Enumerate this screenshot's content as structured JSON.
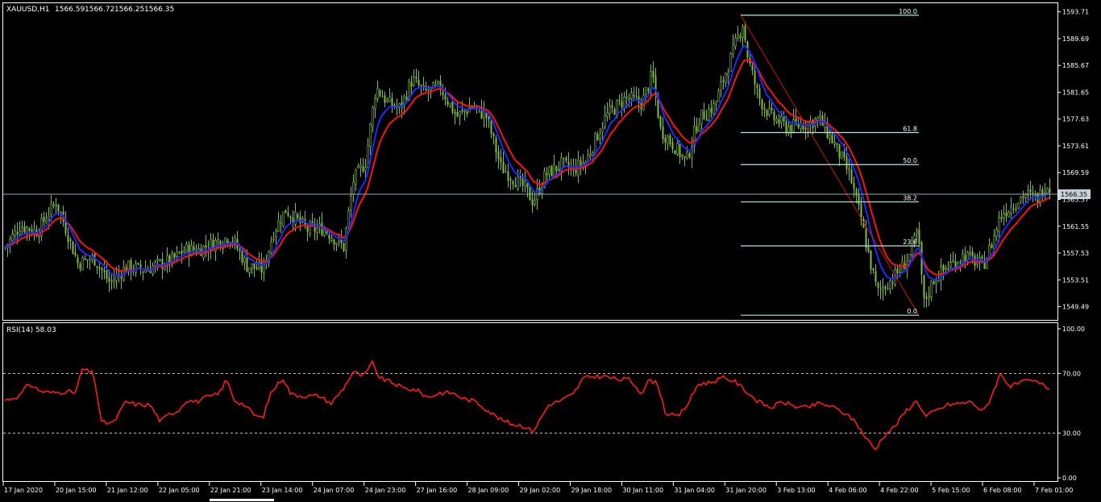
{
  "header": {
    "symbol": "XAUUSD,H1",
    "ohlc": [
      "1566.59",
      "1566.72",
      "1566.25",
      "1566.35"
    ]
  },
  "colors": {
    "background": "#000000",
    "frame": "#ffffff",
    "bull_candle": "#7fbf3f",
    "fast_ma": "#1c2bff",
    "slow_ma": "#ff1010",
    "fib_line": "#b0e6e6",
    "fib_trend": "#cc1010",
    "bid_line": "#8fa6b4",
    "rsi_line": "#ff1a1a",
    "rsi_level": "#bfbfbf"
  },
  "main_panel": {
    "price_ticks": [
      "1593.71",
      "1589.69",
      "1585.67",
      "1581.65",
      "1577.63",
      "1573.61",
      "1569.59",
      "1565.57",
      "1561.55",
      "1557.53",
      "1553.51",
      "1549.49"
    ],
    "current_price": "1566.35",
    "fibonacci": [
      {
        "label": "100.0",
        "price": 1593.2
      },
      {
        "label": "61.8",
        "price": 1575.6
      },
      {
        "label": "50.0",
        "price": 1570.8
      },
      {
        "label": "38.2",
        "price": 1565.2
      },
      {
        "label": "23.6",
        "price": 1558.6
      },
      {
        "label": "0.0",
        "price": 1548.2
      }
    ]
  },
  "rsi_panel": {
    "title": "RSI(14) 58.03",
    "ticks": [
      "100.00",
      "70.00",
      "30.00",
      "0.00"
    ],
    "levels": [
      70,
      30
    ]
  },
  "time_axis": {
    "labels": [
      "17 Jan 2020",
      "20 Jan 15:00",
      "21 Jan 12:00",
      "22 Jan 05:00",
      "22 Jan 21:00",
      "23 Jan 14:00",
      "24 Jan 07:00",
      "24 Jan 23:00",
      "27 Jan 16:00",
      "28 Jan 09:00",
      "29 Jan 02:00",
      "29 Jan 18:00",
      "30 Jan 11:00",
      "31 Jan 04:00",
      "31 Jan 20:00",
      "3 Feb 13:00",
      "4 Feb 06:00",
      "4 Feb 22:00",
      "5 Feb 15:00",
      "6 Feb 08:00",
      "7 Feb 01:00"
    ]
  },
  "chart_data": {
    "type": "line",
    "title": "XAUUSD,H1",
    "ylim": [
      1547.5,
      1595.0
    ],
    "rsi_ylim": [
      0,
      100
    ],
    "grid": false,
    "price_anchors": [
      [
        0,
        1558.4
      ],
      [
        18,
        1561.6
      ],
      [
        40,
        1560.8
      ],
      [
        52,
        1563.2
      ],
      [
        63,
        1565.2
      ],
      [
        73,
        1562.0
      ],
      [
        90,
        1556.0
      ],
      [
        110,
        1556.8
      ],
      [
        130,
        1553.0
      ],
      [
        150,
        1555.4
      ],
      [
        172,
        1555.0
      ],
      [
        190,
        1555.8
      ],
      [
        207,
        1556.4
      ],
      [
        222,
        1558.0
      ],
      [
        240,
        1558.0
      ],
      [
        262,
        1559.2
      ],
      [
        280,
        1560.0
      ],
      [
        300,
        1555.6
      ],
      [
        320,
        1555.0
      ],
      [
        333,
        1560.8
      ],
      [
        348,
        1564.0
      ],
      [
        375,
        1561.0
      ],
      [
        395,
        1561.2
      ],
      [
        420,
        1558.4
      ],
      [
        432,
        1568.4
      ],
      [
        447,
        1571.2
      ],
      [
        460,
        1582.4
      ],
      [
        475,
        1580.0
      ],
      [
        490,
        1579.2
      ],
      [
        505,
        1583.6
      ],
      [
        520,
        1581.6
      ],
      [
        540,
        1582.4
      ],
      [
        560,
        1578.0
      ],
      [
        580,
        1579.6
      ],
      [
        597,
        1578.0
      ],
      [
        615,
        1570.4
      ],
      [
        630,
        1568.8
      ],
      [
        645,
        1567.2
      ],
      [
        655,
        1565.2
      ],
      [
        670,
        1569.2
      ],
      [
        690,
        1570.8
      ],
      [
        705,
        1570.0
      ],
      [
        720,
        1571.2
      ],
      [
        745,
        1578.0
      ],
      [
        770,
        1580.8
      ],
      [
        790,
        1580.0
      ],
      [
        803,
        1584.4
      ],
      [
        813,
        1576.0
      ],
      [
        830,
        1573.6
      ],
      [
        845,
        1571.2
      ],
      [
        860,
        1577.6
      ],
      [
        880,
        1579.6
      ],
      [
        898,
        1586.0
      ],
      [
        915,
        1592.0
      ],
      [
        922,
        1586.4
      ],
      [
        935,
        1580.8
      ],
      [
        950,
        1578.0
      ],
      [
        970,
        1576.4
      ],
      [
        990,
        1576.8
      ],
      [
        1010,
        1577.6
      ],
      [
        1030,
        1573.6
      ],
      [
        1048,
        1569.2
      ],
      [
        1062,
        1562.4
      ],
      [
        1072,
        1556.8
      ],
      [
        1082,
        1551.6
      ],
      [
        1100,
        1553.6
      ],
      [
        1112,
        1555.2
      ],
      [
        1122,
        1557.2
      ],
      [
        1132,
        1560.8
      ],
      [
        1140,
        1550.0
      ],
      [
        1152,
        1553.6
      ],
      [
        1170,
        1555.6
      ],
      [
        1190,
        1557.2
      ],
      [
        1213,
        1555.6
      ],
      [
        1225,
        1559.2
      ],
      [
        1235,
        1563.2
      ],
      [
        1250,
        1564.8
      ],
      [
        1265,
        1566.4
      ],
      [
        1280,
        1565.6
      ],
      [
        1292,
        1568.0
      ],
      [
        1300,
        1566.4
      ]
    ],
    "rsi_anchors": [
      [
        0,
        52
      ],
      [
        18,
        55
      ],
      [
        30,
        63
      ],
      [
        45,
        58
      ],
      [
        60,
        57
      ],
      [
        75,
        58
      ],
      [
        88,
        57
      ],
      [
        96,
        73
      ],
      [
        110,
        70
      ],
      [
        120,
        37
      ],
      [
        135,
        37
      ],
      [
        150,
        51
      ],
      [
        165,
        49
      ],
      [
        180,
        49
      ],
      [
        193,
        38
      ],
      [
        205,
        43
      ],
      [
        215,
        45
      ],
      [
        225,
        52
      ],
      [
        238,
        51
      ],
      [
        250,
        54
      ],
      [
        265,
        56
      ],
      [
        275,
        66
      ],
      [
        285,
        52
      ],
      [
        297,
        49
      ],
      [
        310,
        42
      ],
      [
        320,
        40
      ],
      [
        330,
        57
      ],
      [
        345,
        67
      ],
      [
        355,
        56
      ],
      [
        370,
        55
      ],
      [
        390,
        55
      ],
      [
        405,
        50
      ],
      [
        420,
        60
      ],
      [
        432,
        71
      ],
      [
        445,
        68
      ],
      [
        456,
        77
      ],
      [
        465,
        67
      ],
      [
        480,
        64
      ],
      [
        495,
        60
      ],
      [
        510,
        59
      ],
      [
        525,
        54
      ],
      [
        540,
        57
      ],
      [
        555,
        57
      ],
      [
        570,
        53
      ],
      [
        585,
        51
      ],
      [
        600,
        45
      ],
      [
        615,
        39
      ],
      [
        630,
        36
      ],
      [
        643,
        35
      ],
      [
        655,
        31
      ],
      [
        665,
        40
      ],
      [
        675,
        49
      ],
      [
        690,
        52
      ],
      [
        705,
        56
      ],
      [
        718,
        67
      ],
      [
        730,
        68
      ],
      [
        745,
        68
      ],
      [
        760,
        66
      ],
      [
        775,
        66
      ],
      [
        790,
        57
      ],
      [
        800,
        66
      ],
      [
        810,
        63
      ],
      [
        820,
        43
      ],
      [
        835,
        41
      ],
      [
        848,
        50
      ],
      [
        860,
        63
      ],
      [
        875,
        64
      ],
      [
        890,
        67
      ],
      [
        905,
        65
      ],
      [
        920,
        58
      ],
      [
        935,
        51
      ],
      [
        950,
        47
      ],
      [
        965,
        51
      ],
      [
        980,
        48
      ],
      [
        995,
        47
      ],
      [
        1010,
        50
      ],
      [
        1025,
        48
      ],
      [
        1040,
        44
      ],
      [
        1055,
        38
      ],
      [
        1068,
        27
      ],
      [
        1080,
        19
      ],
      [
        1090,
        28
      ],
      [
        1105,
        35
      ],
      [
        1118,
        45
      ],
      [
        1132,
        52
      ],
      [
        1142,
        41
      ],
      [
        1155,
        45
      ],
      [
        1170,
        49
      ],
      [
        1185,
        50
      ],
      [
        1200,
        51
      ],
      [
        1213,
        44
      ],
      [
        1222,
        52
      ],
      [
        1235,
        70
      ],
      [
        1248,
        61
      ],
      [
        1260,
        64
      ],
      [
        1275,
        65
      ],
      [
        1290,
        62
      ],
      [
        1300,
        58
      ]
    ]
  }
}
